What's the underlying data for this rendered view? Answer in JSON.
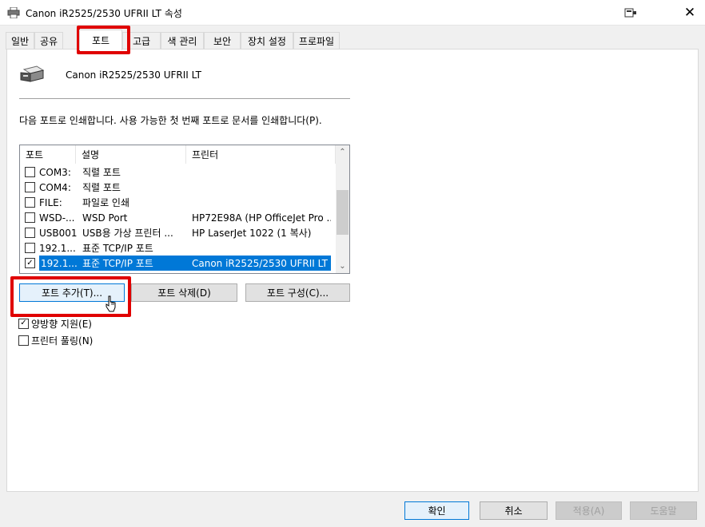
{
  "window": {
    "title": "Canon iR2525/2530 UFRII LT 속성",
    "close_glyph": "✕"
  },
  "tabs": [
    {
      "label": "일반"
    },
    {
      "label": "공유"
    },
    {
      "label": "포트"
    },
    {
      "label": "고급"
    },
    {
      "label": "색 관리"
    },
    {
      "label": "보안"
    },
    {
      "label": "장치 설정"
    },
    {
      "label": "프로파일"
    }
  ],
  "active_tab": "포트",
  "printer": {
    "name": "Canon iR2525/2530 UFRII LT"
  },
  "description": "다음 포트로 인쇄합니다. 사용 가능한 첫 번째 포트로 문서를 인쇄합니다(P).",
  "port_list": {
    "columns": [
      "포트",
      "설명",
      "프린터"
    ],
    "rows": [
      {
        "port": "COM3:",
        "desc": "직렬 포트",
        "printer": "",
        "checked": false
      },
      {
        "port": "COM4:",
        "desc": "직렬 포트",
        "printer": "",
        "checked": false
      },
      {
        "port": "FILE:",
        "desc": "파일로 인쇄",
        "printer": "",
        "checked": false
      },
      {
        "port": "WSD-...",
        "desc": "WSD Port",
        "printer": "HP72E98A (HP OfficeJet Pro ...",
        "checked": false
      },
      {
        "port": "USB001",
        "desc": "USB용 가상 프린터 ...",
        "printer": "HP LaserJet 1022 (1 복사)",
        "checked": false
      },
      {
        "port": "192.1...",
        "desc": "표준 TCP/IP 포트",
        "printer": "",
        "checked": false
      },
      {
        "port": "192.1...",
        "desc": "표준 TCP/IP 포트",
        "printer": "Canon iR2525/2530 UFRII LT",
        "checked": true
      }
    ],
    "selected_row": 6,
    "scroll_up": "⌃",
    "scroll_down": "⌄"
  },
  "port_buttons": {
    "add": "포트 추가(T)...",
    "delete": "포트 삭제(D)",
    "configure": "포트 구성(C)..."
  },
  "options": {
    "bidirectional": {
      "label": "양방향 지원(E)",
      "checked": true
    },
    "pooling": {
      "label": "프린터 풀링(N)",
      "checked": false
    }
  },
  "dialog_buttons": {
    "ok": "확인",
    "cancel": "취소",
    "apply": "적용(A)",
    "help": "도움말"
  },
  "check_mark": "✓",
  "colors": {
    "highlight": "#e00000",
    "selection": "#0078d7"
  }
}
